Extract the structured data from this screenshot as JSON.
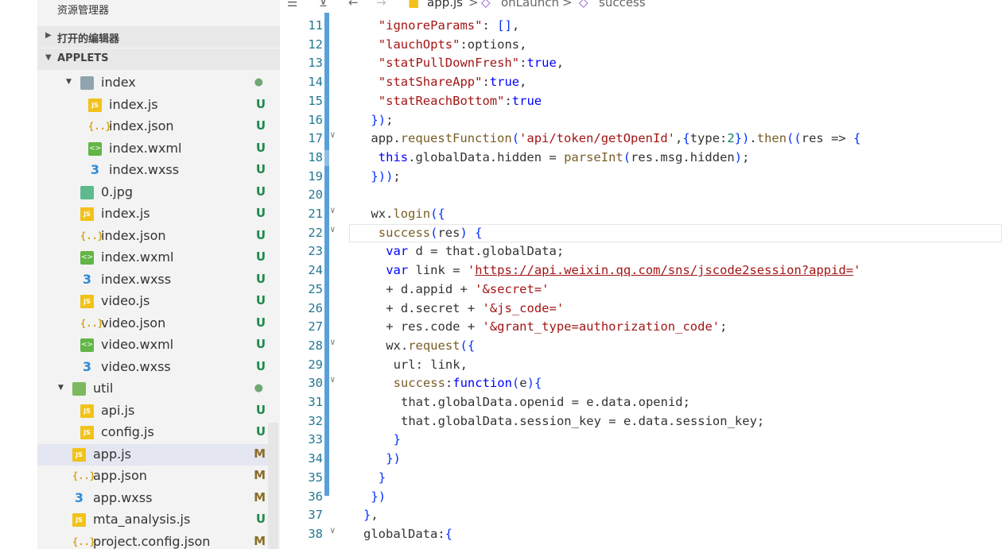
{
  "explorer": {
    "title": "资源管理器",
    "open_editors_label": "打开的编辑器",
    "project_label": "APPLETS"
  },
  "tree": [
    {
      "name": "index",
      "kind": "folder",
      "status": "●",
      "status_kind": "dot",
      "expanded": true
    },
    {
      "name": "index.js",
      "kind": "js",
      "status": "U",
      "status_kind": "u"
    },
    {
      "name": "index.json",
      "kind": "json",
      "status": "U",
      "status_kind": "u"
    },
    {
      "name": "index.wxml",
      "kind": "wxml",
      "status": "U",
      "status_kind": "u"
    },
    {
      "name": "index.wxss",
      "kind": "wxss",
      "status": "U",
      "status_kind": "u"
    },
    {
      "name": "0.jpg",
      "kind": "img",
      "status": "U",
      "status_kind": "u"
    },
    {
      "name": "index.js",
      "kind": "js",
      "status": "U",
      "status_kind": "u"
    },
    {
      "name": "index.json",
      "kind": "json",
      "status": "U",
      "status_kind": "u"
    },
    {
      "name": "index.wxml",
      "kind": "wxml",
      "status": "U",
      "status_kind": "u"
    },
    {
      "name": "index.wxss",
      "kind": "wxss",
      "status": "U",
      "status_kind": "u"
    },
    {
      "name": "video.js",
      "kind": "js",
      "status": "U",
      "status_kind": "u"
    },
    {
      "name": "video.json",
      "kind": "json",
      "status": "U",
      "status_kind": "u"
    },
    {
      "name": "video.wxml",
      "kind": "wxml",
      "status": "U",
      "status_kind": "u"
    },
    {
      "name": "video.wxss",
      "kind": "wxss",
      "status": "U",
      "status_kind": "u"
    },
    {
      "name": "util",
      "kind": "folder-util",
      "status": "●",
      "status_kind": "dot",
      "expanded": true
    },
    {
      "name": "api.js",
      "kind": "js",
      "status": "U",
      "status_kind": "u"
    },
    {
      "name": "config.js",
      "kind": "js",
      "status": "U",
      "status_kind": "u"
    },
    {
      "name": "app.js",
      "kind": "js",
      "status": "M",
      "status_kind": "m",
      "selected": true
    },
    {
      "name": "app.json",
      "kind": "json",
      "status": "M",
      "status_kind": "m"
    },
    {
      "name": "app.wxss",
      "kind": "wxss",
      "status": "M",
      "status_kind": "m"
    },
    {
      "name": "mta_analysis.js",
      "kind": "js",
      "status": "U",
      "status_kind": "u"
    },
    {
      "name": "project.config.json",
      "kind": "json",
      "status": "M",
      "status_kind": "m"
    }
  ],
  "breadcrumb": {
    "file": "app.js",
    "sep": ">",
    "item1": "onLaunch",
    "item2": "success"
  },
  "icons": {
    "js": "JS",
    "json": "{..}",
    "wxml": "<>",
    "wxss": "3"
  },
  "editor": {
    "lines": [
      {
        "n": "11",
        "code": "\"ignoreParams\": [],"
      },
      {
        "n": "12",
        "code": "\"lauchOpts\":options,"
      },
      {
        "n": "13",
        "code": "\"statPullDownFresh\":true,"
      },
      {
        "n": "14",
        "code": "\"statShareApp\":true,"
      },
      {
        "n": "15",
        "code": "\"statReachBottom\":true"
      },
      {
        "n": "16",
        "code": "});"
      },
      {
        "n": "17",
        "code": "app.requestFunction('api/token/getOpenId',{type:2}).then((res => {"
      },
      {
        "n": "18",
        "code": "this.globalData.hidden = parseInt(res.msg.hidden);"
      },
      {
        "n": "19",
        "code": "}));"
      },
      {
        "n": "20",
        "code": ""
      },
      {
        "n": "21",
        "code": "wx.login({"
      },
      {
        "n": "22",
        "code": "success(res) {"
      },
      {
        "n": "23",
        "code": "var d = that.globalData;"
      },
      {
        "n": "24",
        "code": "var link = 'https://api.weixin.qq.com/sns/jscode2session?appid='"
      },
      {
        "n": "25",
        "code": "+ d.appid + '&secret='"
      },
      {
        "n": "26",
        "code": "+ d.secret + '&js_code='"
      },
      {
        "n": "27",
        "code": "+ res.code + '&grant_type=authorization_code';"
      },
      {
        "n": "28",
        "code": "wx.request({"
      },
      {
        "n": "29",
        "code": "url: link,"
      },
      {
        "n": "30",
        "code": "success:function(e){"
      },
      {
        "n": "31",
        "code": "that.globalData.openid = e.data.openid;"
      },
      {
        "n": "32",
        "code": "that.globalData.session_key = e.data.session_key;"
      },
      {
        "n": "33",
        "code": "}"
      },
      {
        "n": "34",
        "code": "})"
      },
      {
        "n": "35",
        "code": "}"
      },
      {
        "n": "36",
        "code": "})"
      },
      {
        "n": "37",
        "code": "},"
      },
      {
        "n": "38",
        "code": "globalData:{"
      }
    ]
  },
  "colors": {
    "line_number": "#237893",
    "keyword": "#0000ff",
    "string": "#a31515",
    "function": "#795e26",
    "modified_gutter": "#5aa0d8",
    "untracked": "#1e8a4c",
    "modified": "#8a6d28"
  }
}
